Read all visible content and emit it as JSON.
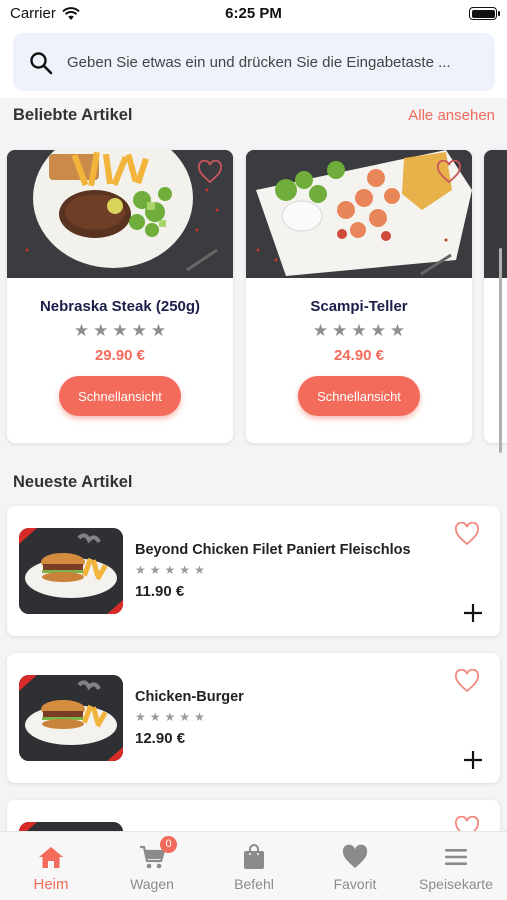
{
  "status_bar": {
    "carrier": "Carrier",
    "time": "6:25 PM"
  },
  "search": {
    "placeholder": "Geben Sie etwas ein und drücken Sie die Eingabetaste ..."
  },
  "popular": {
    "title": "Beliebte Artikel",
    "see_all": "Alle ansehen",
    "items": [
      {
        "name": "Nebraska Steak (250g)",
        "price": "29.90 €",
        "rating": 0,
        "button": "Schnellansicht"
      },
      {
        "name": "Scampi-Teller",
        "price": "24.90 €",
        "rating": 0,
        "button": "Schnellansicht"
      }
    ]
  },
  "newest": {
    "title": "Neueste Artikel",
    "items": [
      {
        "name": "Beyond Chicken Filet Paniert Fleischlos",
        "price": "11.90 €",
        "rating": 0
      },
      {
        "name": "Chicken-Burger",
        "price": "12.90 €",
        "rating": 0
      }
    ]
  },
  "tabs": [
    {
      "label": "Heim",
      "icon": "home-icon",
      "active": true
    },
    {
      "label": "Wagen",
      "icon": "cart-icon",
      "badge": "0"
    },
    {
      "label": "Befehl",
      "icon": "bag-icon"
    },
    {
      "label": "Favorit",
      "icon": "heart-icon"
    },
    {
      "label": "Speisekarte",
      "icon": "menu-icon"
    }
  ],
  "colors": {
    "accent": "#f26b5b",
    "title_navy": "#1c1f4a",
    "background": "#f4f4f6"
  }
}
